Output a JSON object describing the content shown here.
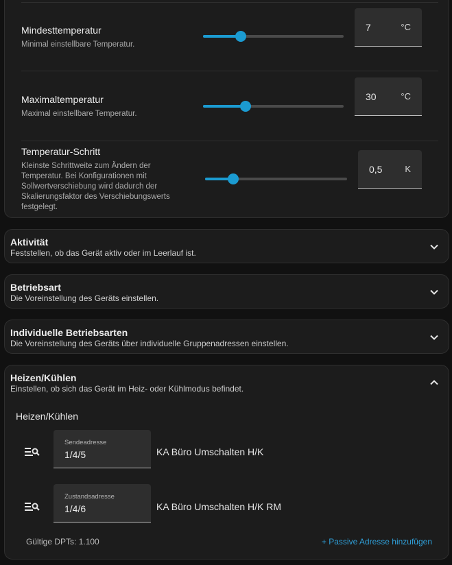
{
  "settings": {
    "min_temp": {
      "title": "Mindesttemperatur",
      "description": "Minimal einstellbare Temperatur.",
      "value": "7",
      "unit": "°C",
      "slider_level": 0.27
    },
    "max_temp": {
      "title": "Maximaltemperatur",
      "description": "Maximal einstellbare Temperatur.",
      "value": "30",
      "unit": "°C",
      "slider_level": 0.3
    },
    "temp_step": {
      "title": "Temperatur-Schritt",
      "description": "Kleinste Schrittweite zum Ändern der Temperatur. Bei Konfigurationen mit Sollwertverschiebung wird dadurch der Skalierungsfaktor des Verschiebungswerts festgelegt.",
      "value": "0,5",
      "unit": "K",
      "slider_level": 0.2
    }
  },
  "accordions": {
    "activity": {
      "title": "Aktivität",
      "subtitle": "Feststellen, ob das Gerät aktiv oder im Leerlauf ist.",
      "expanded": false
    },
    "mode": {
      "title": "Betriebsart",
      "subtitle": "Die Voreinstellung des Geräts einstellen.",
      "expanded": false
    },
    "custom_modes": {
      "title": "Individuelle Betriebsarten",
      "subtitle": "Die Voreinstellung des Geräts über individuelle Gruppenadressen einstellen.",
      "expanded": false
    },
    "heat_cool": {
      "title": "Heizen/Kühlen",
      "subtitle": "Einstellen, ob sich das Gerät im Heiz- oder Kühlmodus befindet.",
      "expanded": true,
      "section_heading": "Heizen/Kühlen",
      "send": {
        "label": "Sendeadresse",
        "value": "1/4/5",
        "name": "KA Büro Umschalten H/K"
      },
      "state": {
        "label": "Zustandsadresse",
        "value": "1/4/6",
        "name": "KA Büro Umschalten H/K RM"
      },
      "dpt_text": "Gültige DPTs: 1.100",
      "passive_link": "+ Passive Adresse hinzufügen"
    }
  },
  "colors": {
    "accent": "#1b9bd1",
    "link": "#2f9fd8",
    "card_bg": "#1c1c1c",
    "page_bg": "#111111"
  },
  "icons": {
    "collapsed": "chevron-down-icon",
    "expanded": "chevron-up-icon",
    "address_search": "list-search-icon"
  }
}
